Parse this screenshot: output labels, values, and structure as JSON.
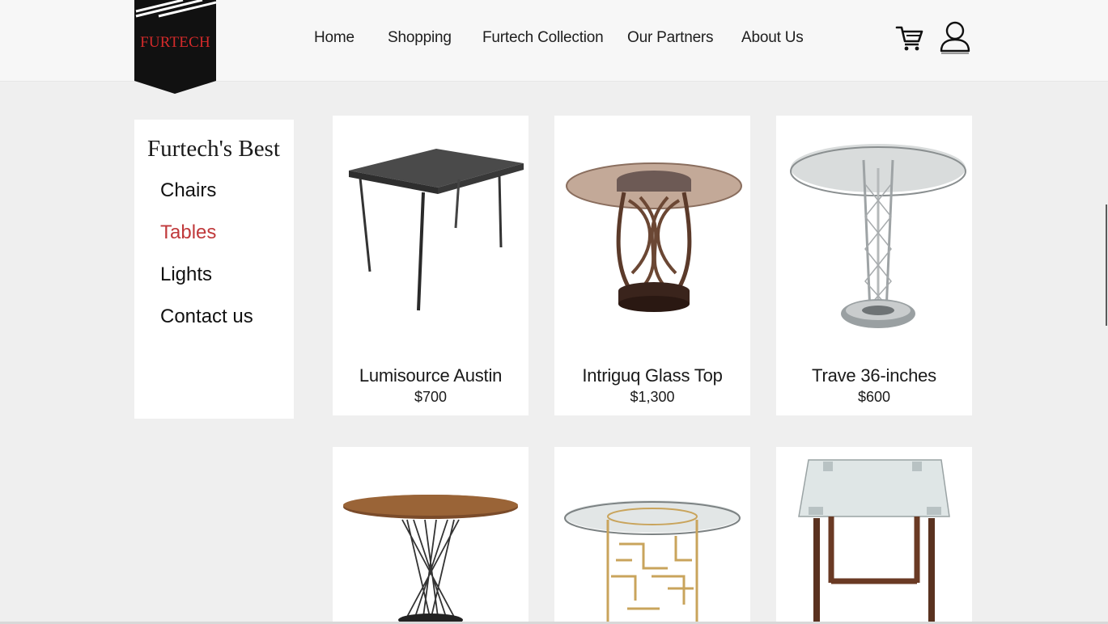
{
  "brand": {
    "logo_text": "FURTECH",
    "accent_color": "#d42a2a"
  },
  "nav": {
    "items": [
      {
        "label": "Home"
      },
      {
        "label": "Shopping"
      },
      {
        "label": "Furtech Collection"
      },
      {
        "label": "Our Partners"
      },
      {
        "label": "About Us"
      }
    ],
    "icons": [
      "cart-icon",
      "user-icon"
    ]
  },
  "sidebar": {
    "title": "Furtech's Best",
    "items": [
      {
        "label": "Chairs",
        "active": false
      },
      {
        "label": "Tables",
        "active": true
      },
      {
        "label": "Lights",
        "active": false
      },
      {
        "label": "Contact us",
        "active": false
      }
    ],
    "active_color": "#c0393b"
  },
  "products": [
    {
      "name": "Lumisource Austin",
      "price": "$700",
      "image": "dark-metal-rectangular-table"
    },
    {
      "name": "Intriguq Glass Top",
      "price": "$1,300",
      "image": "round-glass-pedestal-table"
    },
    {
      "name": "Trave 36-inches",
      "price": "$600",
      "image": "round-glass-chrome-bistro-table"
    },
    {
      "name": "",
      "price": "",
      "image": "round-wood-wire-base-table"
    },
    {
      "name": "",
      "price": "",
      "image": "round-glass-gold-base-table"
    },
    {
      "name": "",
      "price": "",
      "image": "rectangular-glass-wood-leg-table"
    }
  ]
}
